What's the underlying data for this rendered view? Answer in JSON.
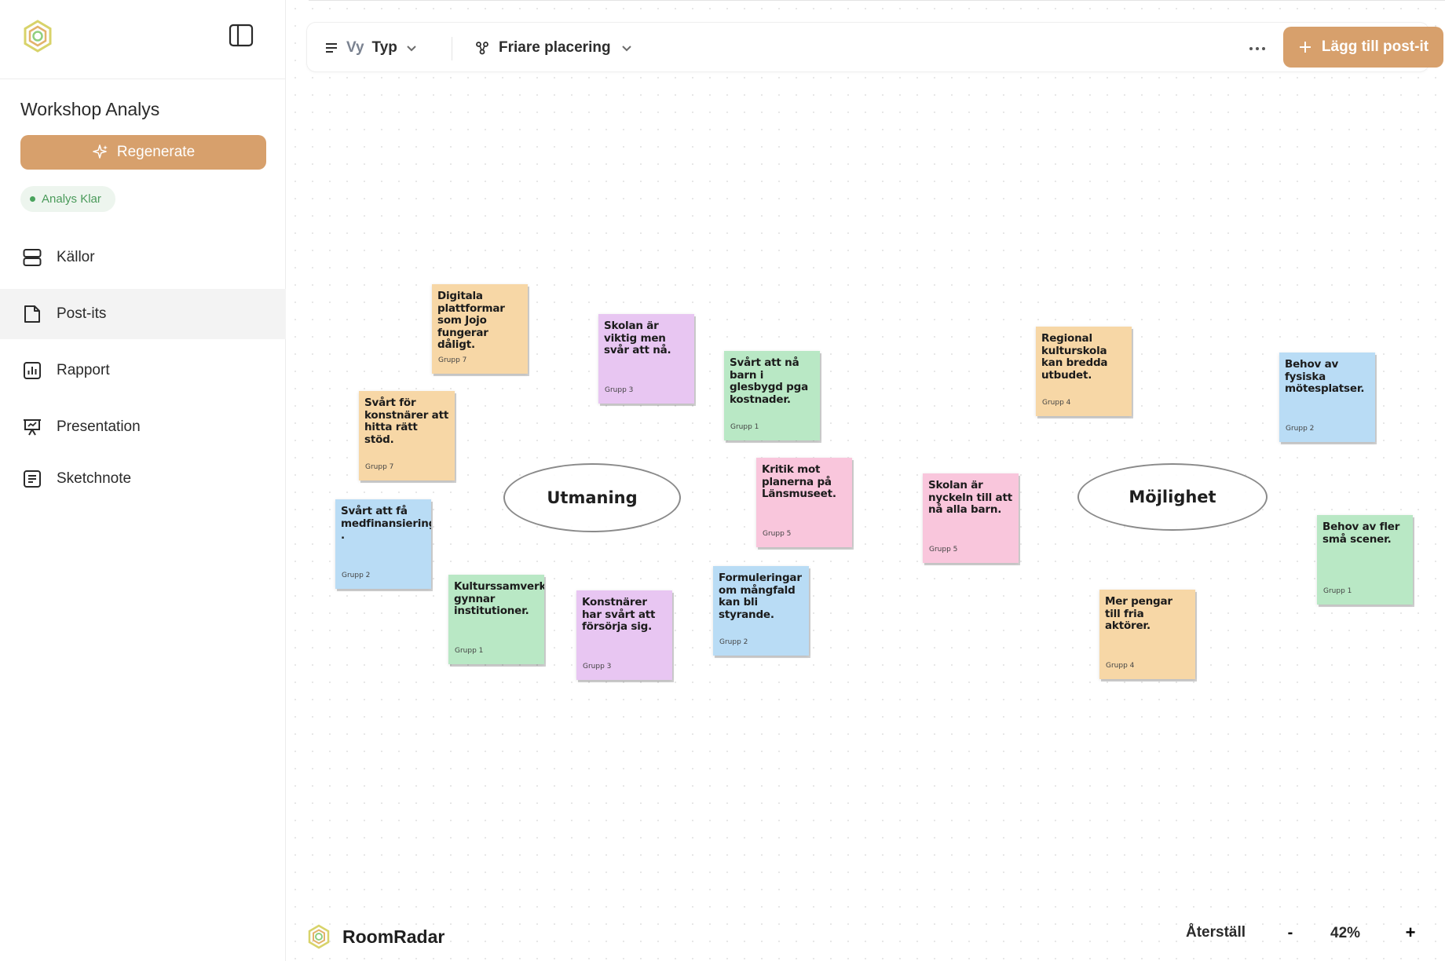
{
  "app": {
    "brand_name": "RoomRadar",
    "accent_color": "#d7a06c"
  },
  "sidebar": {
    "workspace_title": "Workshop Analys",
    "regenerate_label": "Regenerate",
    "status_label": "Analys Klar",
    "items": [
      {
        "label": "Källor",
        "icon": "database-icon"
      },
      {
        "label": "Post-its",
        "icon": "document-icon",
        "active": true
      },
      {
        "label": "Rapport",
        "icon": "bar-chart-icon"
      },
      {
        "label": "Presentation",
        "icon": "presentation-icon"
      },
      {
        "label": "Sketchnote",
        "icon": "note-icon"
      }
    ]
  },
  "toolbar": {
    "view_prefix": "Vy",
    "view_value": "Typ",
    "placement_label": "Friare placering",
    "more_label": "···",
    "add_label": "Lägg till post-it"
  },
  "canvas": {
    "categories": [
      {
        "label": "Utmaning"
      },
      {
        "label": "Möjlighet"
      }
    ],
    "notes": [
      {
        "text": "Digitala plattformar som Jojo fungerar dåligt.",
        "group": "Grupp 7",
        "color": "orange"
      },
      {
        "text": "Skolan är viktig men svår att nå.",
        "group": "Grupp 3",
        "color": "purple"
      },
      {
        "text": "Svårt att nå barn i glesbygd pga kostnader.",
        "group": "Grupp 1",
        "color": "green"
      },
      {
        "text": "Svårt för konstnärer att hitta rätt stöd.",
        "group": "Grupp 7",
        "color": "orange"
      },
      {
        "text": "Svårt att få medfinansiering .",
        "group": "Grupp 2",
        "color": "blue"
      },
      {
        "text": "Kulturssamverkansmodellen gynnar institutioner.",
        "group": "Grupp 1",
        "color": "green"
      },
      {
        "text": "Konstnärer har svårt att försörja sig.",
        "group": "Grupp 3",
        "color": "purple"
      },
      {
        "text": "Kritik mot planerna på Länsmuseet.",
        "group": "Grupp 5",
        "color": "pink"
      },
      {
        "text": "Formuleringar om mångfald kan bli styrande.",
        "group": "Grupp 2",
        "color": "blue"
      },
      {
        "text": "Regional kulturskola kan bredda utbudet.",
        "group": "Grupp 4",
        "color": "orange"
      },
      {
        "text": "Skolan är nyckeln till att nå alla barn.",
        "group": "Grupp 5",
        "color": "pink"
      },
      {
        "text": "Mer pengar till fria aktörer.",
        "group": "Grupp 4",
        "color": "orange"
      },
      {
        "text": "Behov av fysiska mötesplatser.",
        "group": "Grupp 2",
        "color": "blue"
      },
      {
        "text": "Behov av fler små scener.",
        "group": "Grupp 1",
        "color": "green"
      }
    ]
  },
  "footer": {
    "reset_label": "Återställ",
    "zoom_out_label": "-",
    "zoom_level": "42%",
    "zoom_in_label": "+"
  }
}
